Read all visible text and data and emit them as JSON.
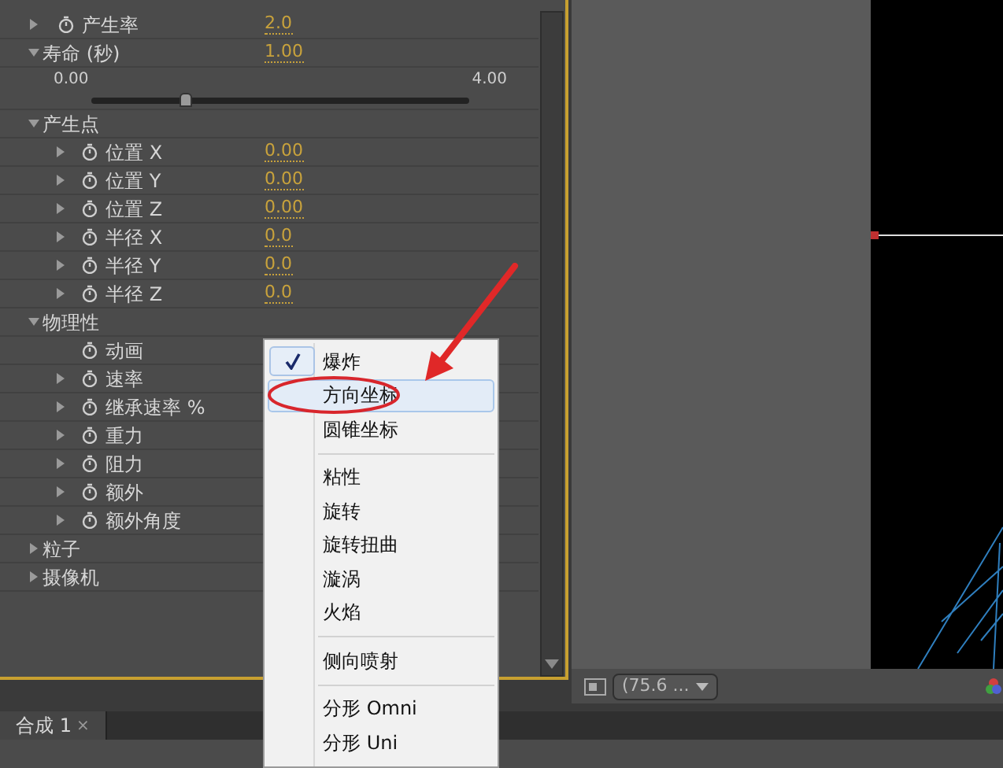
{
  "properties": [
    {
      "label": "产生率",
      "value": "2.0",
      "expanded": false,
      "stopwatch": true
    },
    {
      "label": "寿命 (秒)",
      "value": "1.00",
      "expanded": true,
      "slider": {
        "min": "0.00",
        "max": "4.00",
        "level": 0.25
      }
    },
    {
      "label": "产生点",
      "expanded": true,
      "children": [
        {
          "label": "位置 X",
          "value": "0.00",
          "expanded": false,
          "stopwatch": true
        },
        {
          "label": "位置 Y",
          "value": "0.00",
          "expanded": false,
          "stopwatch": true
        },
        {
          "label": "位置 Z",
          "value": "0.00",
          "expanded": false,
          "stopwatch": true
        },
        {
          "label": "半径 X",
          "value": "0.0",
          "expanded": false,
          "stopwatch": true
        },
        {
          "label": "半径 Y",
          "value": "0.0",
          "expanded": false,
          "stopwatch": true
        },
        {
          "label": "半径 Z",
          "value": "0.0",
          "expanded": false,
          "stopwatch": true
        }
      ]
    },
    {
      "label": "物理性",
      "expanded": true,
      "children": [
        {
          "label": "动画",
          "stopwatch": true
        },
        {
          "label": "速率",
          "expanded": false,
          "stopwatch": true
        },
        {
          "label": "继承速率 %",
          "expanded": false,
          "stopwatch": true
        },
        {
          "label": "重力",
          "expanded": false,
          "stopwatch": true
        },
        {
          "label": "阻力",
          "expanded": false,
          "stopwatch": true
        },
        {
          "label": "额外",
          "expanded": false,
          "stopwatch": true
        },
        {
          "label": "额外角度",
          "expanded": false,
          "stopwatch": true
        }
      ]
    },
    {
      "label": "粒子",
      "expanded": false
    },
    {
      "label": "摄像机",
      "expanded": false
    }
  ],
  "viewer": {
    "zoom": "(75.6 ..."
  },
  "tab": {
    "label": "合成 1",
    "close": "×"
  },
  "menu": [
    {
      "kind": "item",
      "label": "爆炸",
      "checked": true,
      "selected": false
    },
    {
      "kind": "item",
      "label": "方向坐标",
      "checked": false,
      "selected": true
    },
    {
      "kind": "item",
      "label": "圆锥坐标",
      "checked": false,
      "selected": false
    },
    {
      "kind": "separator"
    },
    {
      "kind": "item",
      "label": "粘性",
      "checked": false,
      "selected": false
    },
    {
      "kind": "item",
      "label": "旋转",
      "checked": false,
      "selected": false
    },
    {
      "kind": "item",
      "label": "旋转扭曲",
      "checked": false,
      "selected": false
    },
    {
      "kind": "item",
      "label": "漩涡",
      "checked": false,
      "selected": false
    },
    {
      "kind": "item",
      "label": "火焰",
      "checked": false,
      "selected": false
    },
    {
      "kind": "separator"
    },
    {
      "kind": "item",
      "label": "侧向喷射",
      "checked": false,
      "selected": false
    },
    {
      "kind": "separator"
    },
    {
      "kind": "item",
      "label": "分形 Omni",
      "checked": false,
      "selected": false
    },
    {
      "kind": "item",
      "label": "分形 Uni",
      "checked": false,
      "selected": false
    }
  ]
}
